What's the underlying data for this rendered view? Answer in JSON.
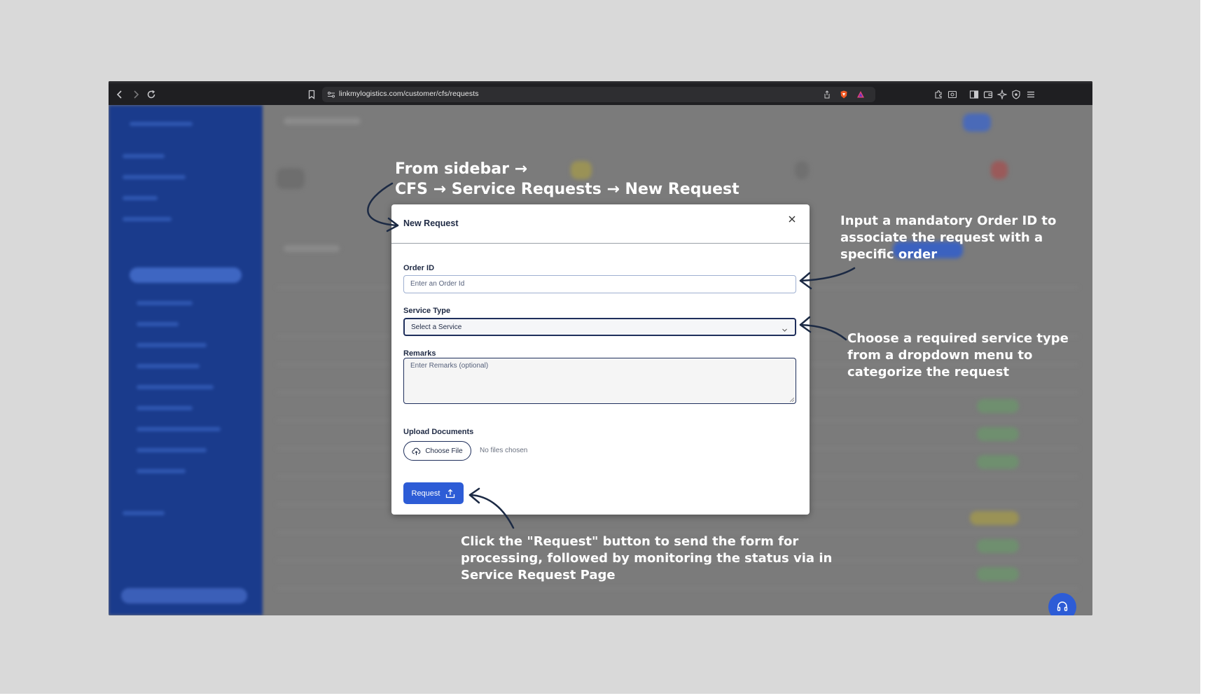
{
  "browser": {
    "url": "linkmylogistics.com/customer/cfs/requests"
  },
  "modal": {
    "title": "New Request",
    "order_id": {
      "label": "Order ID",
      "placeholder": "Enter an Order Id"
    },
    "service_type": {
      "label": "Service Type",
      "selected": "Select a Service"
    },
    "remarks": {
      "label": "Remarks",
      "placeholder": "Enter Remarks (optional)"
    },
    "upload": {
      "label": "Upload Documents",
      "button": "Choose File",
      "status": "No files chosen"
    },
    "submit_label": "Request"
  },
  "annotations": {
    "nav_line1": "From sidebar →",
    "nav_line2": "CFS → Service Requests → New Request",
    "order_id_line1": "Input a mandatory Order ID to",
    "order_id_line2": "associate the request with a",
    "order_id_line3": "specific order",
    "service_line1": "Choose a required service type",
    "service_line2": "from a dropdown menu to",
    "service_line3": "categorize the request",
    "submit_line1": "Click the \"Request\" button to send the form for",
    "submit_line2": "processing, followed by monitoring the status via in",
    "submit_line3": "Service Request Page"
  },
  "icons": [
    "back-icon",
    "forward-icon",
    "reload-icon",
    "bookmark-icon",
    "site-settings-icon",
    "share-icon",
    "brave-shield-icon",
    "brave-rewards-icon",
    "extensions-icon",
    "screenshot-icon",
    "sidebar-icon",
    "wallet-icon",
    "leo-ai-icon",
    "vpn-icon",
    "menu-icon",
    "close-icon",
    "chevron-down-icon",
    "upload-cloud-icon",
    "upload-icon",
    "headset-icon"
  ],
  "colors": {
    "accent": "#2d5cd6",
    "sidebar": "#1a3b8c",
    "annotation_text": "#ffffff",
    "arrow": "#1c2a44"
  }
}
